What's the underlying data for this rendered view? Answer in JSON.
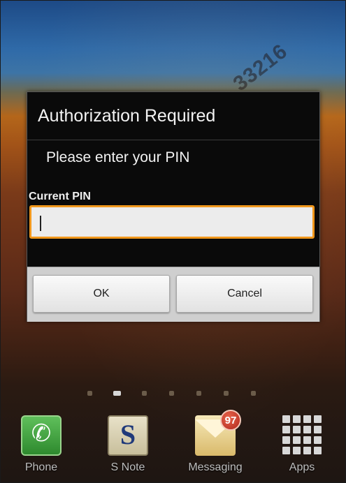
{
  "watermark": "33216",
  "dialog": {
    "title": "Authorization Required",
    "message": "Please enter your PIN",
    "field_label": "Current PIN",
    "field_value": "",
    "ok_label": "OK",
    "cancel_label": "Cancel"
  },
  "pager": {
    "page_count": 7,
    "active_index": 1
  },
  "dock": {
    "items": [
      {
        "label": "Phone",
        "icon": "phone-icon"
      },
      {
        "label": "S Note",
        "icon": "s-note-icon"
      },
      {
        "label": "Messaging",
        "icon": "messaging-icon",
        "badge": "97"
      },
      {
        "label": "Apps",
        "icon": "apps-grid-icon"
      }
    ]
  },
  "colors": {
    "input_focus_border": "#f0971c",
    "badge": "#c0392b",
    "dialog_background": "#0a0a0a"
  }
}
